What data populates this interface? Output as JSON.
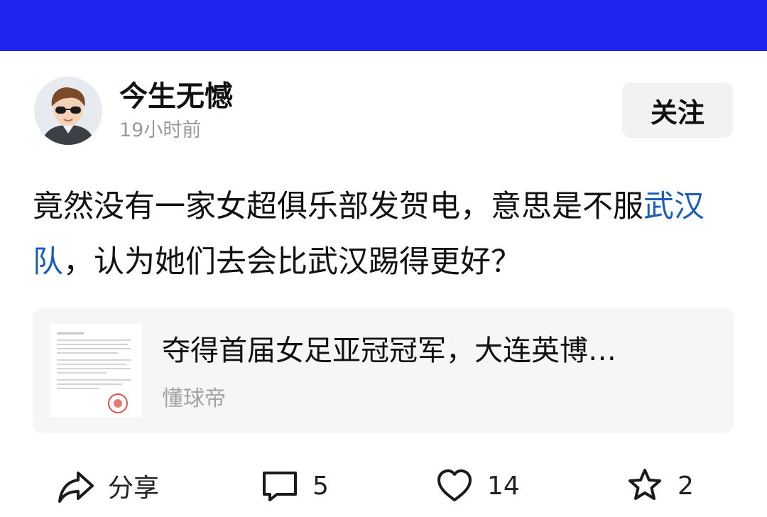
{
  "post": {
    "author": {
      "name": "今生无憾",
      "time": "19小时前"
    },
    "follow_label": "关注",
    "content": {
      "before_tag": "竟然没有一家女超俱乐部发贺电，意思是不服",
      "tag": "武汉队",
      "after_tag": "，认为她们去会比武汉踢得更好？"
    },
    "card": {
      "title": "夺得首届女足亚冠冠军，大连英博…",
      "source": "懂球帝"
    },
    "actions": {
      "share_label": "分享",
      "comments": "5",
      "likes": "14",
      "favorites": "2"
    }
  },
  "colors": {
    "topbar": "#1f25f0",
    "tag_link": "#1a5fb4",
    "seal": "#d9534f"
  },
  "icons": [
    "avatar-cartoon-boy",
    "share-arrow-icon",
    "comment-icon",
    "heart-icon",
    "star-icon"
  ]
}
